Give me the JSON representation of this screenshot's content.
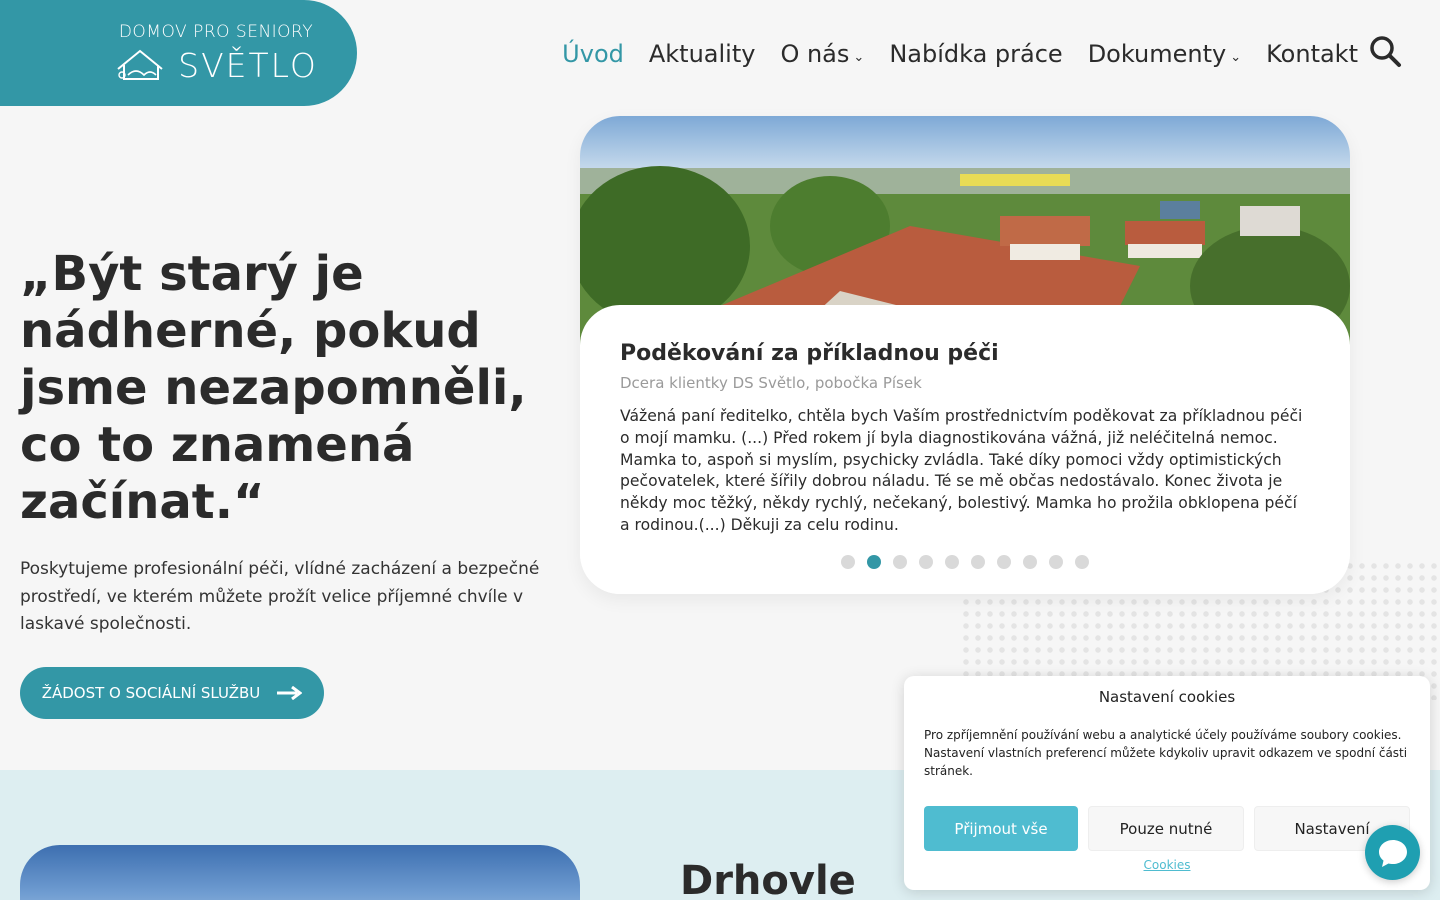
{
  "header": {
    "logo_top": "DOMOV PRO SENIORY",
    "logo_name": "SVĚTLO",
    "nav": [
      {
        "label": "Úvod",
        "active": true
      },
      {
        "label": "Aktuality"
      },
      {
        "label": "O nás",
        "has_dropdown": true
      },
      {
        "label": "Nabídka práce"
      },
      {
        "label": "Dokumenty",
        "has_dropdown": true
      },
      {
        "label": "Kontakt"
      }
    ],
    "search_icon": "search-icon"
  },
  "hero": {
    "quote": "„Být starý je nádherné, pokud jsme nezapomněli, co to znamená začínat.“",
    "description": "Poskytujeme profesionální péči, vlídné zacházení a bezpečné prostředí, ve kterém můžete prožít velice příjemné chvíle v laskavé společnosti.",
    "cta_label": "ŽÁDOST O SOCIÁLNÍ SLUŽBU"
  },
  "slider": {
    "title": "Poděkování za příkladnou péči",
    "subtitle": "Dcera klientky DS Světlo, pobočka Písek",
    "text": "Vážená paní ředitelko, chtěla bych Vaším prostřednictvím poděkovat za příkladnou péči o mojí mamku. (...) Před rokem jí byla diagnostikována vážná, již neléčitelná nemoc. Mamka to, aspoň si myslím, psychicky zvládla. Také díky pomoci vždy optimistických pečovatelek, které šířily dobrou náladu. Té se mě občas nedostávalo. Konec života je někdy moc těžký, někdy rychlý, nečekaný, bolestivý. Mamka ho prožila obklopena péčí a rodinou.(...) Děkuji za celu rodinu.",
    "slide_count": 10,
    "active_slide": 2
  },
  "lower": {
    "title": "Drhovle"
  },
  "cookie": {
    "title": "Nastavení cookies",
    "body": "Pro zpříjemnění používání webu a analytické účely používáme soubory cookies. Nastavení vlastních preferencí můžete kdykoliv upravit odkazem ve spodní části stránek.",
    "accept_all": "Přijmout vše",
    "only_necessary": "Pouze nutné",
    "settings": "Nastavení",
    "link": "Cookies"
  },
  "colors": {
    "brand": "#3397a6",
    "cookie_accent": "#4fbcd0",
    "background": "#f6f6f6",
    "lower_bg": "#ddeef1"
  }
}
